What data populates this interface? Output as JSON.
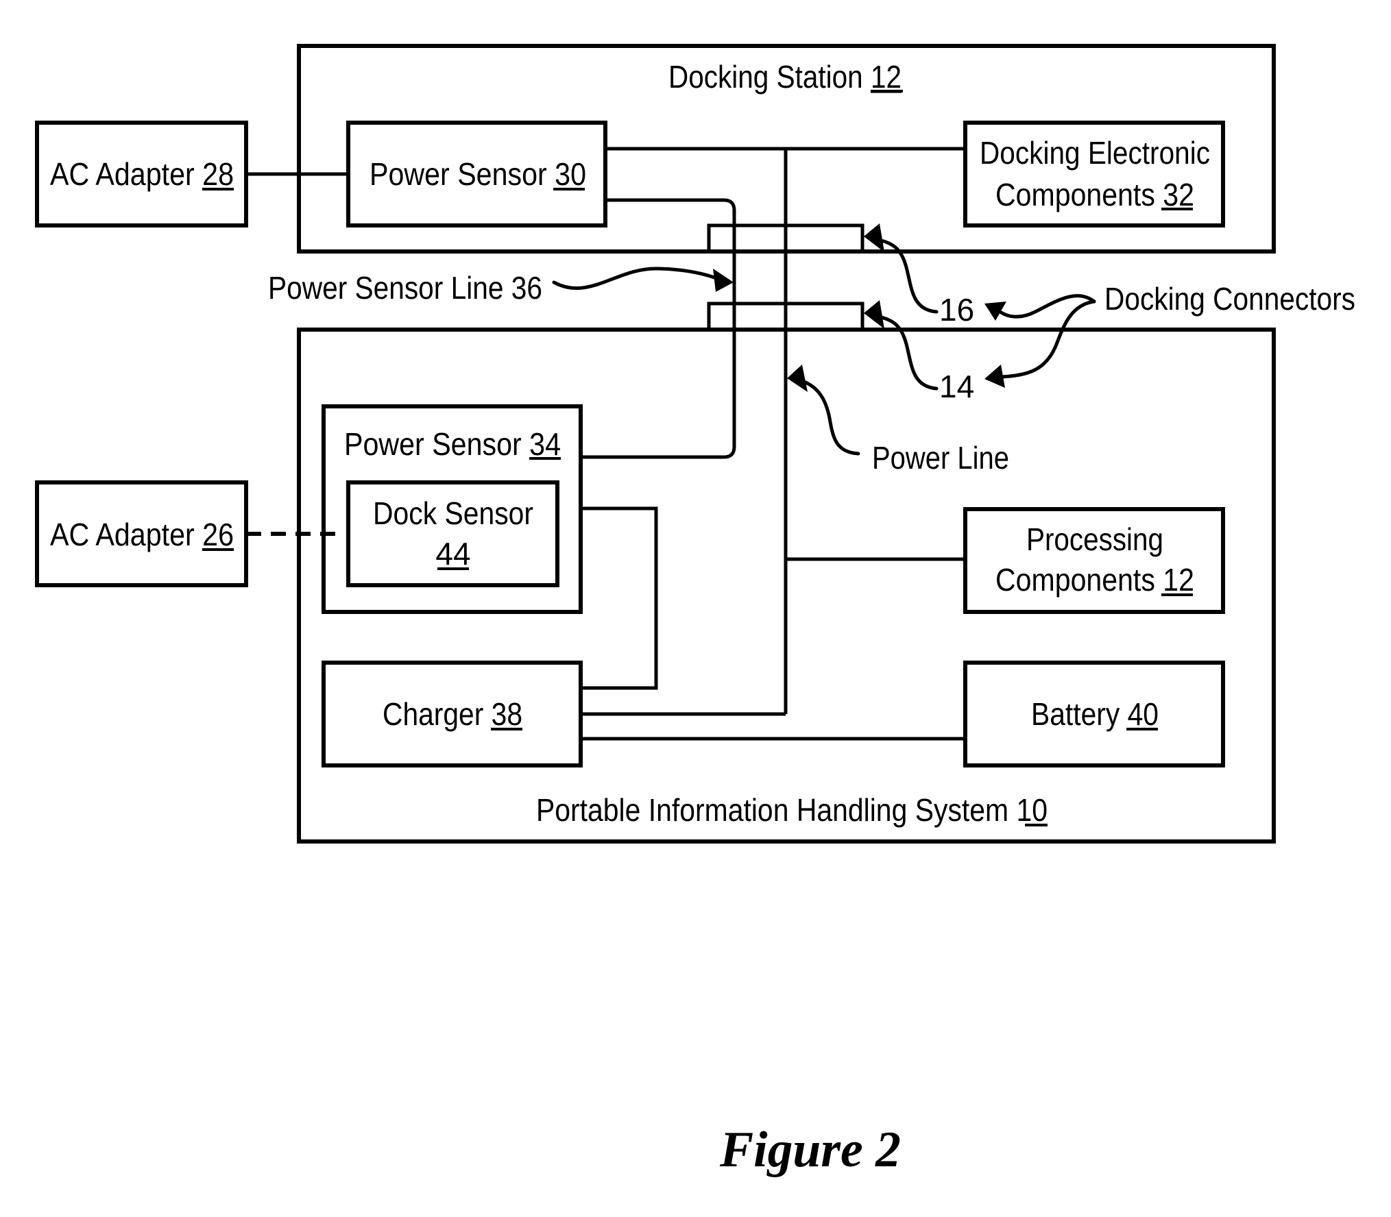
{
  "figure": {
    "caption": "Figure 2",
    "text_color": "#000000",
    "background": "#ffffff"
  },
  "blocks": {
    "docking_station": {
      "label": "Docking Station",
      "ref": "12"
    },
    "portable_ihs": {
      "label": "Portable Information Handling System",
      "ref": "10"
    },
    "ac_adapter_28": {
      "label": "AC Adapter",
      "ref": "28"
    },
    "ac_adapter_26": {
      "label": "AC Adapter",
      "ref": "26"
    },
    "power_sensor_30": {
      "label": "Power Sensor",
      "ref": "30"
    },
    "power_sensor_34": {
      "label": "Power Sensor",
      "ref": "34"
    },
    "dock_sensor_44": {
      "label": "Dock Sensor",
      "ref": "44"
    },
    "docking_electronic_32": {
      "line1": "Docking Electronic",
      "line2": "Components",
      "ref": "32"
    },
    "processing_12": {
      "line1": "Processing",
      "line2": "Components",
      "ref": "12"
    },
    "charger_38": {
      "label": "Charger",
      "ref": "38"
    },
    "battery_40": {
      "label": "Battery",
      "ref": "40"
    }
  },
  "annotations": {
    "power_sensor_line": "Power Sensor Line 36",
    "docking_connectors": "Docking Connectors",
    "connector_16": "16",
    "connector_14": "14",
    "power_line": "Power Line"
  }
}
